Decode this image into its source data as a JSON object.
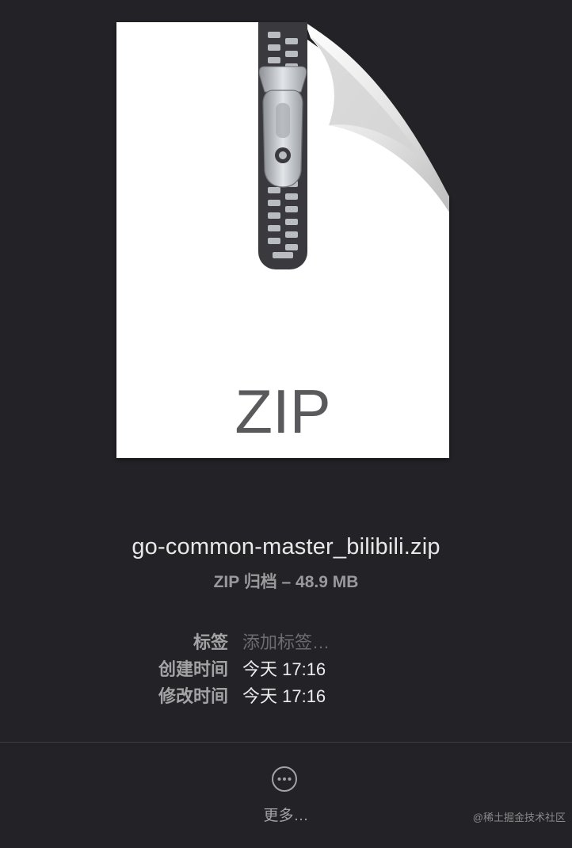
{
  "preview": {
    "icon_text": "ZIP",
    "file_name": "go-common-master_bilibili.zip",
    "file_meta": "ZIP 归档 – 48.9 MB"
  },
  "info": {
    "tags_label": "标签",
    "tags_placeholder": "添加标签…",
    "created_label": "创建时间",
    "created_value": "今天 17:16",
    "modified_label": "修改时间",
    "modified_value": "今天 17:16"
  },
  "actions": {
    "more_label": "更多…",
    "more_icon": "ellipsis-circle-icon"
  },
  "watermark": "@稀土掘金技术社区",
  "colors": {
    "background": "#232226",
    "page": "#ffffff",
    "zipper": "#3a3a3e"
  }
}
